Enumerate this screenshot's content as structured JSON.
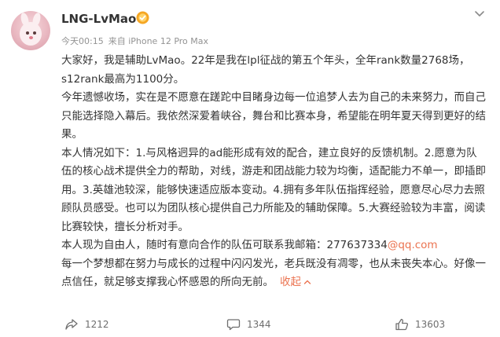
{
  "post": {
    "username": "LNG-LvMao",
    "meta": {
      "time": "今天00:15",
      "source": "来自 iPhone 12 Pro Max"
    },
    "paragraphs": [
      "大家好，我是辅助LvMao。22年是我在lpl征战的第五个年头，全年rank数量2768场，s12rank最高为1100分。",
      "今年遗憾收场，实在是不愿意在蹉跎中目睹身边每一位追梦人去为自己的未来努力，而自己只能选择隐入幕后。我依然深爱着峡谷，舞台和比赛本身，希望能在明年夏天得到更好的结果。",
      "本人情况如下：1.与风格迥异的ad能形成有效的配合，建立良好的反馈机制。2.愿意为队伍的核心战术提供全力的帮助，对线，游走和团战能力较为均衡，适配能力不单一，即插即用。3.英雄池较深，能够快速适应版本变动。4.拥有多年队伍指挥经验，愿意尽心尽力去照顾队员感受。也可以为团队核心提供自己力所能及的辅助保障。5.大赛经验较为丰富，阅读比赛较快，擅长分析对手。"
    ],
    "contact_prefix": "本人现为自由人，随时有意向合作的队伍可联系我邮箱：277637334",
    "contact_domain": "@qq.com",
    "closing": "每一个梦想都在努力与成长的过程中闪闪发光，老兵既没有凋零，也从未丧失本心。好像一点信任，就足够支撑我心怀感恩的所向无前。",
    "collapse_label": "收起"
  },
  "actions": {
    "forward_count": "1212",
    "comment_count": "1344",
    "like_count": "13603"
  },
  "colors": {
    "link": "#eb7350",
    "text": "#333333",
    "meta": "#939393",
    "badge": "#f5a623"
  },
  "icons": [
    "more-icon",
    "verified-badge-icon",
    "forward-icon",
    "comment-icon",
    "like-icon",
    "chevron-up-icon"
  ]
}
